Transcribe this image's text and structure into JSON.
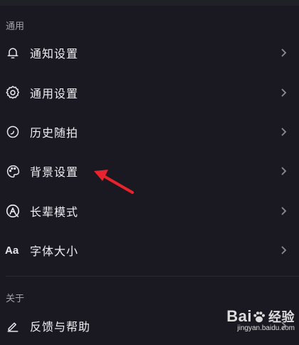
{
  "sections": [
    {
      "header": "通用",
      "items": [
        {
          "label": "通知设置",
          "icon": "bell-icon"
        },
        {
          "label": "通用设置",
          "icon": "gear-icon"
        },
        {
          "label": "历史随拍",
          "icon": "history-circle-icon"
        },
        {
          "label": "背景设置",
          "icon": "palette-icon"
        },
        {
          "label": "长辈模式",
          "icon": "elder-mode-icon"
        },
        {
          "label": "字体大小",
          "icon": "font-size-icon"
        }
      ]
    },
    {
      "header": "关于",
      "items": [
        {
          "label": "反馈与帮助",
          "icon": "edit-pen-icon"
        }
      ]
    }
  ],
  "font_size_icon_text": "Aa",
  "annotation": {
    "color": "#e8232e",
    "points_to": "背景设置"
  },
  "watermark": {
    "logo_text": "Bai",
    "logo_suffix": "经验",
    "url": "jingyan.baidu.com"
  }
}
